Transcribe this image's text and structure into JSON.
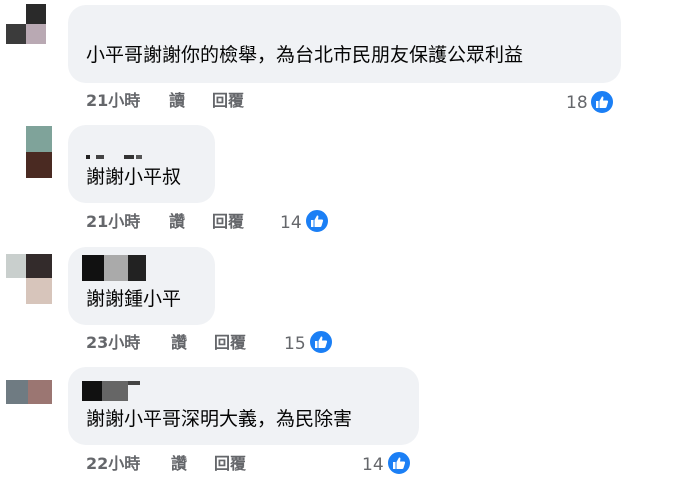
{
  "comments": [
    {
      "text": "小平哥謝謝你的檢舉，為台北市民朋友保護公眾利益",
      "time": "21小時",
      "read_label": "讀",
      "reply_label": "回覆",
      "likes": "18"
    },
    {
      "text": "謝謝小平叔",
      "time": "21小時",
      "read_label": "讚",
      "reply_label": "回覆",
      "likes": "14"
    },
    {
      "text": "謝謝鍾小平",
      "time": "23小時",
      "read_label": "讚",
      "reply_label": "回覆",
      "likes": "15"
    },
    {
      "text": "謝謝小平哥深明大義，為民除害",
      "time": "22小時",
      "read_label": "讚",
      "reply_label": "回覆",
      "likes": "14"
    }
  ],
  "colors": {
    "bubble": "#f0f2f5",
    "meta_text": "#65676b",
    "like_blue": "#1b7ff5"
  },
  "icons": {
    "like": "thumbs-up-icon"
  }
}
